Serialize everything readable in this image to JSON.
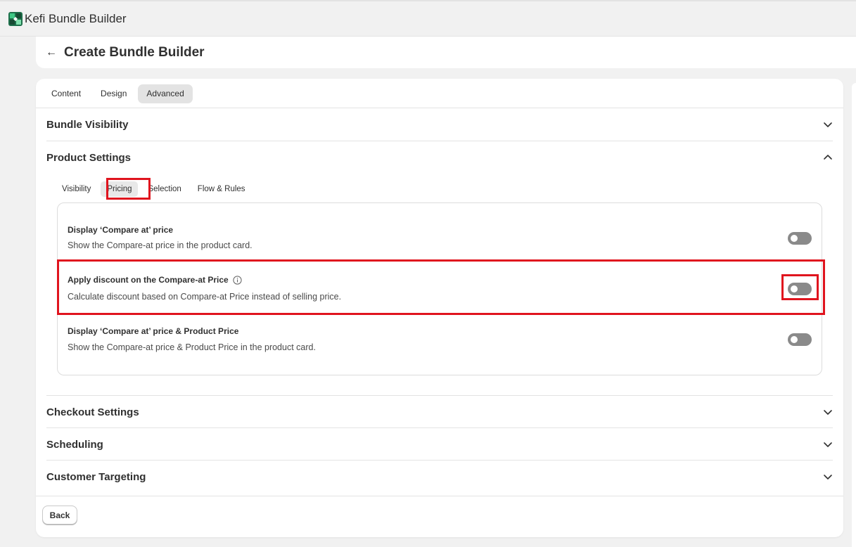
{
  "app": {
    "title": "Kefi Bundle Builder"
  },
  "page": {
    "title": "Create Bundle Builder"
  },
  "tabs": [
    {
      "label": "Content",
      "active": false
    },
    {
      "label": "Design",
      "active": false
    },
    {
      "label": "Advanced",
      "active": true
    }
  ],
  "sections": {
    "bundle_visibility": {
      "title": "Bundle Visibility",
      "expanded": false
    },
    "product_settings": {
      "title": "Product Settings",
      "expanded": true
    },
    "checkout_settings": {
      "title": "Checkout Settings",
      "expanded": false
    },
    "scheduling": {
      "title": "Scheduling",
      "expanded": false
    },
    "customer_targeting": {
      "title": "Customer Targeting",
      "expanded": false
    }
  },
  "product_subtabs": [
    {
      "label": "Visibility",
      "active": false
    },
    {
      "label": "Pricing",
      "active": true
    },
    {
      "label": "Selection",
      "active": false
    },
    {
      "label": "Flow & Rules",
      "active": false
    }
  ],
  "pricing_settings": [
    {
      "title": "Display ‘Compare at’ price",
      "description": "Show the Compare-at price in the product card.",
      "enabled": false,
      "info_icon": false
    },
    {
      "title": "Apply discount on the Compare-at Price",
      "description": "Calculate discount based on Compare-at Price instead of selling price.",
      "enabled": false,
      "info_icon": true
    },
    {
      "title": "Display ‘Compare at’ price & Product Price",
      "description": "Show the Compare-at price & Product Price in the product card.",
      "enabled": false,
      "info_icon": false
    }
  ],
  "footer": {
    "back_label": "Back"
  },
  "colors": {
    "highlight": "#e0141e",
    "toggle_off": "#8a8a8a",
    "logo_green": "#2fa36b"
  }
}
